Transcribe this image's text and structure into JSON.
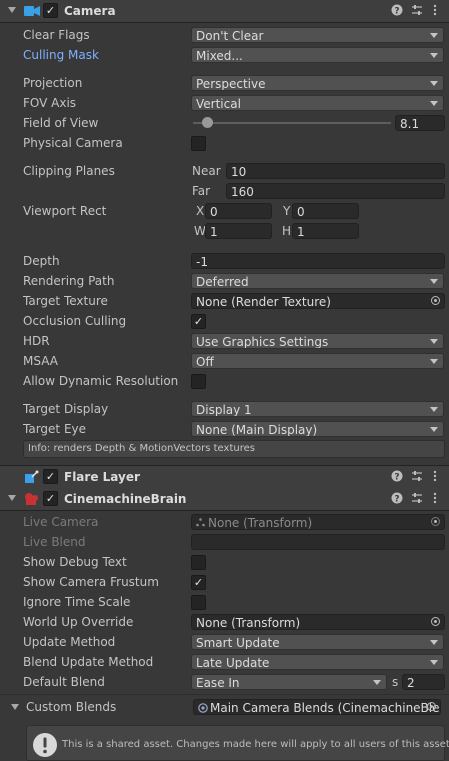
{
  "camera": {
    "title": "Camera",
    "clear_flags": {
      "label": "Clear Flags",
      "value": "Don't Clear"
    },
    "culling_mask": {
      "label": "Culling Mask",
      "value": "Mixed..."
    },
    "projection": {
      "label": "Projection",
      "value": "Perspective"
    },
    "fov_axis": {
      "label": "FOV Axis",
      "value": "Vertical"
    },
    "field_of_view": {
      "label": "Field of View",
      "value": "8.1",
      "slider_fraction": 0.05
    },
    "physical_camera": {
      "label": "Physical Camera",
      "checked": false
    },
    "clipping_planes": {
      "label": "Clipping Planes",
      "near_label": "Near",
      "near": "10",
      "far_label": "Far",
      "far": "160"
    },
    "viewport_rect": {
      "label": "Viewport Rect",
      "x_label": "X",
      "x": "0",
      "y_label": "Y",
      "y": "0",
      "w_label": "W",
      "w": "1",
      "h_label": "H",
      "h": "1"
    },
    "depth": {
      "label": "Depth",
      "value": "-1"
    },
    "rendering_path": {
      "label": "Rendering Path",
      "value": "Deferred"
    },
    "target_texture": {
      "label": "Target Texture",
      "value": "None (Render Texture)"
    },
    "occlusion_culling": {
      "label": "Occlusion Culling",
      "checked": true
    },
    "hdr": {
      "label": "HDR",
      "value": "Use Graphics Settings"
    },
    "msaa": {
      "label": "MSAA",
      "value": "Off"
    },
    "allow_dynamic_resolution": {
      "label": "Allow Dynamic Resolution",
      "checked": false
    },
    "target_display": {
      "label": "Target Display",
      "value": "Display 1"
    },
    "target_eye": {
      "label": "Target Eye",
      "value": "None (Main Display)"
    },
    "info": "Info: renders Depth & MotionVectors textures"
  },
  "flare_layer": {
    "title": "Flare Layer"
  },
  "brain": {
    "title": "CinemachineBrain",
    "live_camera": {
      "label": "Live Camera",
      "value": "None (Transform)"
    },
    "live_blend": {
      "label": "Live Blend",
      "value": ""
    },
    "show_debug_text": {
      "label": "Show Debug Text",
      "checked": false
    },
    "show_camera_frustum": {
      "label": "Show Camera Frustum",
      "checked": true
    },
    "ignore_time_scale": {
      "label": "Ignore Time Scale",
      "checked": false
    },
    "world_up_override": {
      "label": "World Up Override",
      "value": "None (Transform)"
    },
    "update_method": {
      "label": "Update Method",
      "value": "Smart Update"
    },
    "blend_update_method": {
      "label": "Blend Update Method",
      "value": "Late Update"
    },
    "default_blend": {
      "label": "Default Blend",
      "value": "Ease In",
      "s_label": "s",
      "seconds": "2"
    },
    "custom_blends": {
      "label": "Custom Blends",
      "value": "Main Camera Blends (CinemachineBle"
    },
    "warning": "This is a shared asset.  Changes made here will apply to all users of this asset."
  },
  "icons": {
    "help": "help-icon",
    "settings": "settings-sliders-icon",
    "menu": "kebab-menu-icon"
  },
  "colors": {
    "panel": "#383838",
    "header": "#3e3e3e",
    "link": "#7fb0ff",
    "field": "#2a2a2a",
    "dropdown": "#515151"
  }
}
